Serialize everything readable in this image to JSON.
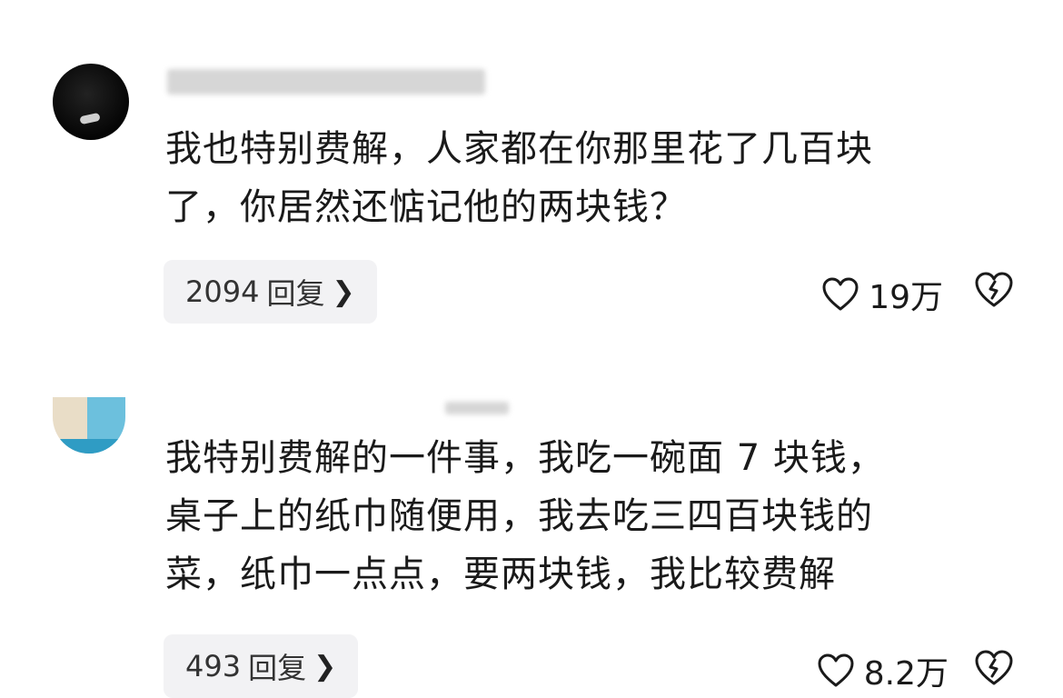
{
  "comments": [
    {
      "text_lines": [
        "我也特别费解，人家都在你那里花了几百块",
        "了，你居然还惦记他的两块钱？"
      ],
      "reply_count": "2094",
      "reply_label": "回复",
      "likes": "19万"
    },
    {
      "text_lines": [
        "我特别费解的一件事，我吃一碗面 7 块钱，",
        "桌子上的纸巾随便用，我去吃三四百块钱的",
        "菜，纸巾一点点，要两块钱，我比较费解"
      ],
      "reply_count": "493",
      "reply_label": "回复",
      "likes": "8.2万"
    }
  ],
  "icons": {
    "like": "heart-outline-icon",
    "dislike": "broken-heart-outline-icon",
    "reply_chevron": "chevron-right-icon"
  },
  "colors": {
    "text": "#1a1a1a",
    "reply_bg": "#f2f2f4"
  }
}
